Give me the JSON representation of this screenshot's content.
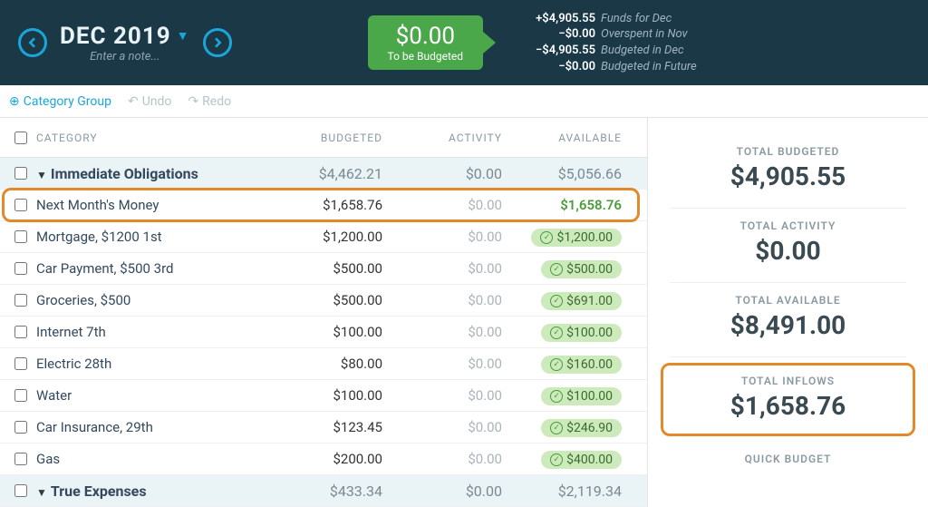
{
  "header": {
    "month_label": "DEC 2019",
    "note_placeholder": "Enter a note...",
    "tbb_amount": "$0.00",
    "tbb_label": "To be Budgeted",
    "summary": [
      {
        "value": "+$4,905.55",
        "desc": "Funds for Dec"
      },
      {
        "value": "−$0.00",
        "desc": "Overspent in Nov"
      },
      {
        "value": "−$4,905.55",
        "desc": "Budgeted in Dec"
      },
      {
        "value": "−$0.00",
        "desc": "Budgeted in Future"
      }
    ]
  },
  "toolbar": {
    "add_group": "Category Group",
    "undo": "Undo",
    "redo": "Redo"
  },
  "columns": {
    "category": "CATEGORY",
    "budgeted": "BUDGETED",
    "activity": "ACTIVITY",
    "available": "AVAILABLE"
  },
  "groups": [
    {
      "name": "Immediate Obligations",
      "budgeted": "$4,462.21",
      "activity": "$0.00",
      "available": "$5,056.66",
      "rows": [
        {
          "name": "Next Month's Money",
          "budgeted": "$1,658.76",
          "activity": "$0.00",
          "available": "$1,658.76",
          "highlight": true,
          "funded": false
        },
        {
          "name": "Mortgage, $1200 1st",
          "budgeted": "$1,200.00",
          "activity": "$0.00",
          "available": "$1,200.00",
          "highlight": false,
          "funded": true
        },
        {
          "name": "Car Payment, $500 3rd",
          "budgeted": "$500.00",
          "activity": "$0.00",
          "available": "$500.00",
          "highlight": false,
          "funded": true
        },
        {
          "name": "Groceries, $500",
          "budgeted": "$500.00",
          "activity": "$0.00",
          "available": "$691.00",
          "highlight": false,
          "funded": true
        },
        {
          "name": "Internet 7th",
          "budgeted": "$100.00",
          "activity": "$0.00",
          "available": "$100.00",
          "highlight": false,
          "funded": true
        },
        {
          "name": "Electric 28th",
          "budgeted": "$80.00",
          "activity": "$0.00",
          "available": "$160.00",
          "highlight": false,
          "funded": true
        },
        {
          "name": "Water",
          "budgeted": "$100.00",
          "activity": "$0.00",
          "available": "$100.00",
          "highlight": false,
          "funded": true
        },
        {
          "name": "Car Insurance, 29th",
          "budgeted": "$123.45",
          "activity": "$0.00",
          "available": "$246.90",
          "highlight": false,
          "funded": true
        },
        {
          "name": "Gas",
          "budgeted": "$200.00",
          "activity": "$0.00",
          "available": "$400.00",
          "highlight": false,
          "funded": true
        }
      ]
    },
    {
      "name": "True Expenses",
      "budgeted": "$433.34",
      "activity": "$0.00",
      "available": "$2,119.34",
      "rows": []
    }
  ],
  "sidebar": {
    "total_budgeted_label": "TOTAL BUDGETED",
    "total_budgeted": "$4,905.55",
    "total_activity_label": "TOTAL ACTIVITY",
    "total_activity": "$0.00",
    "total_available_label": "TOTAL AVAILABLE",
    "total_available": "$8,491.00",
    "total_inflows_label": "TOTAL INFLOWS",
    "total_inflows": "$1,658.76",
    "quick_budget_label": "QUICK BUDGET"
  }
}
